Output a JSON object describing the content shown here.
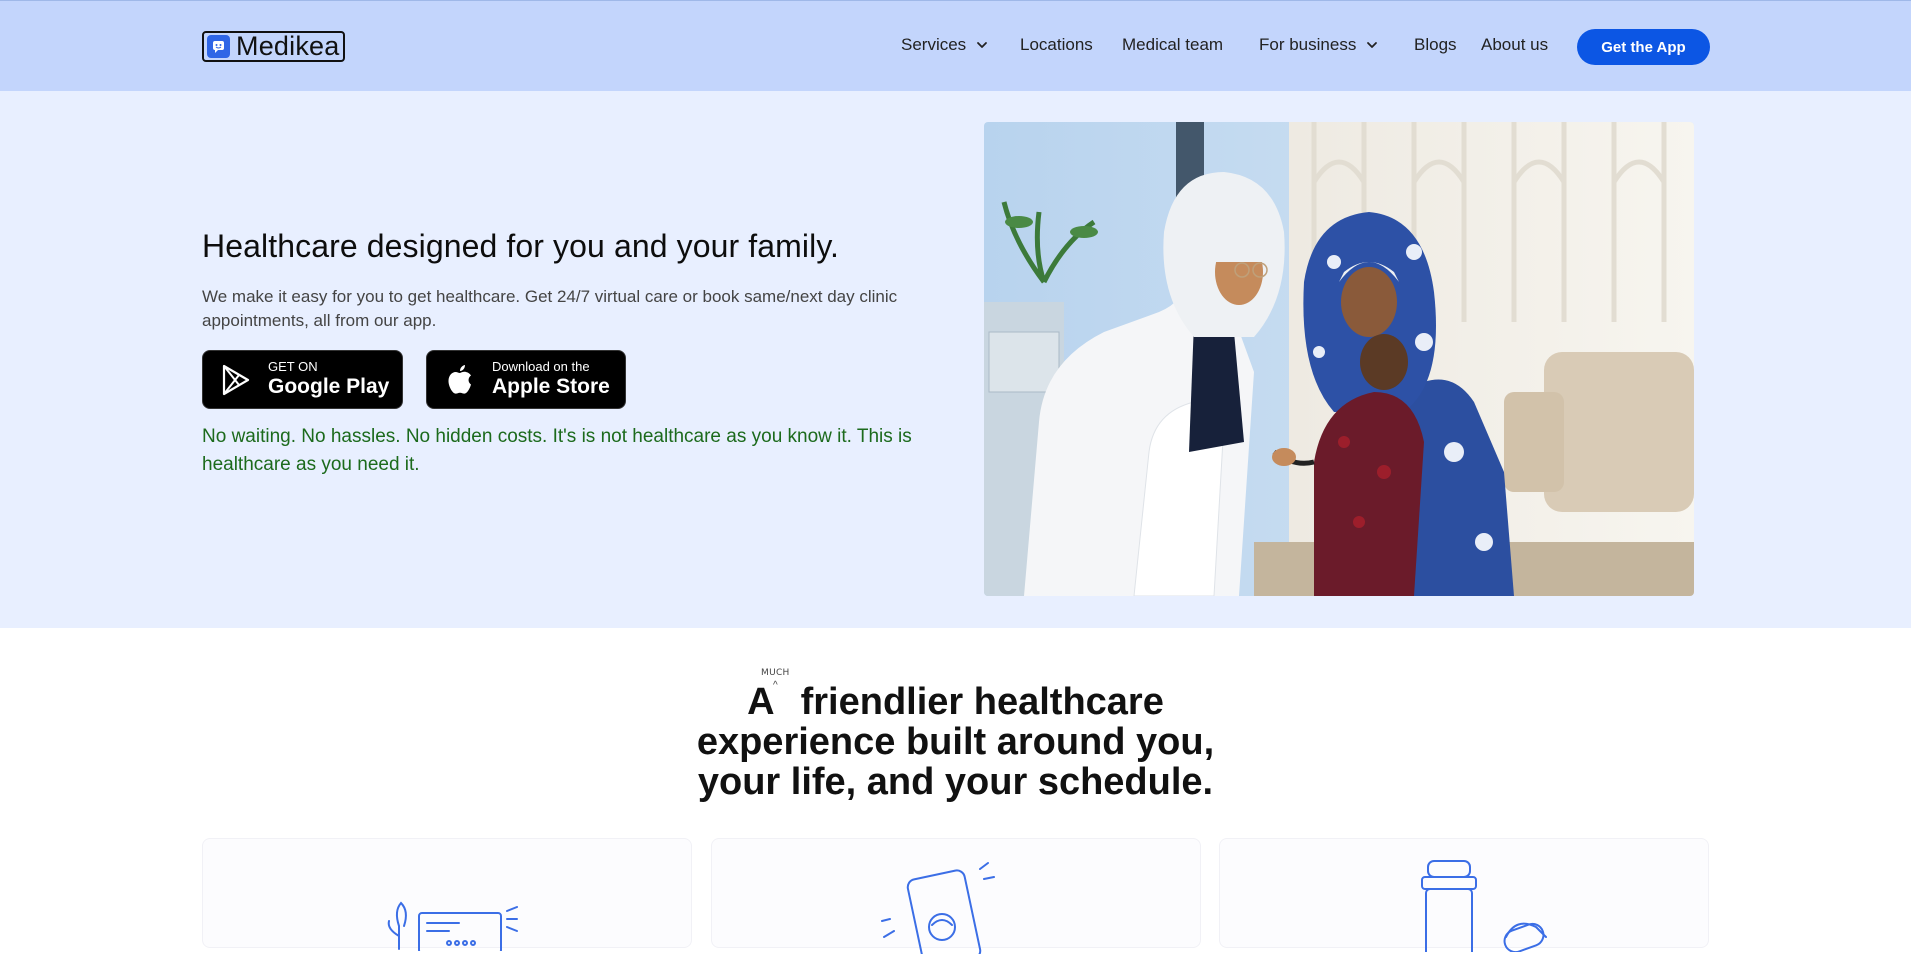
{
  "brand": {
    "name": "Medikea",
    "accent": "#0c56e4",
    "nav_bg": "#c3d5fc",
    "hero_bg": "#e8efff"
  },
  "nav": {
    "items": [
      {
        "label": "Services",
        "has_dropdown": true
      },
      {
        "label": "Locations",
        "has_dropdown": false
      },
      {
        "label": "Medical team",
        "has_dropdown": false
      },
      {
        "label": "For business",
        "has_dropdown": true
      },
      {
        "label": "Blogs",
        "has_dropdown": false
      },
      {
        "label": "About us",
        "has_dropdown": false
      }
    ],
    "cta_label": "Get the App"
  },
  "hero": {
    "title": "Healthcare designed for you and your family.",
    "description": "We make it easy for you to get healthcare. Get 24/7 virtual care or book same/next day clinic appointments, all from our app.",
    "google_play": {
      "small": "GET ON",
      "big": "Google Play",
      "icon": "google-play-icon"
    },
    "apple_store": {
      "small": "Download on the",
      "big": "Apple Store",
      "icon": "apple-icon"
    },
    "tagline": "No waiting. No hassles. No hidden costs. It's is not healthcare as you know it. This is healthcare as you need it.",
    "tagline_color": "#1c6a1c"
  },
  "section2": {
    "annotation": "MUCH",
    "title_line1_a": "A",
    "title_line1_b": "friendlier healthcare",
    "title_line2": "experience built around you,",
    "title_line3": "your life, and your schedule."
  }
}
